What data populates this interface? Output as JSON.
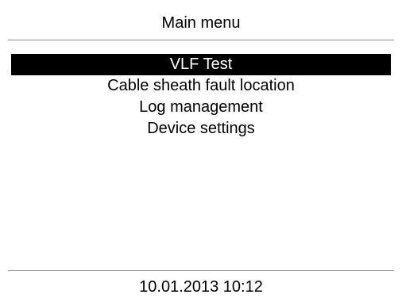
{
  "header": {
    "title": "Main menu"
  },
  "menu": {
    "items": [
      {
        "label": "VLF Test",
        "selected": true
      },
      {
        "label": "Cable sheath fault location",
        "selected": false
      },
      {
        "label": "Log management",
        "selected": false
      },
      {
        "label": "Device settings",
        "selected": false
      }
    ]
  },
  "footer": {
    "datetime": "10.01.2013 10:12"
  },
  "colors": {
    "selection_background": "#000000",
    "selection_text": "#ffffff",
    "divider": "#8a8a8a"
  }
}
